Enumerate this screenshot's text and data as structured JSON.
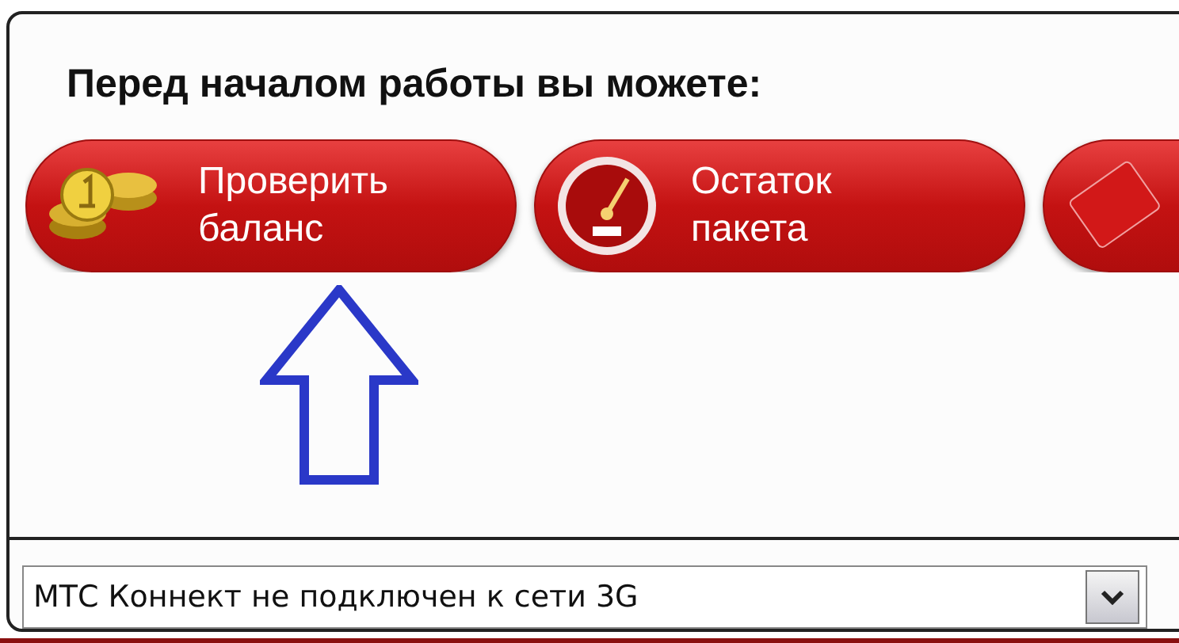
{
  "heading": "Перед началом работы вы можете:",
  "actions": [
    {
      "kind": "coins",
      "label": "Проверить баланс"
    },
    {
      "kind": "gauge",
      "label": "Остаток пакета"
    },
    {
      "kind": "card"
    }
  ],
  "status_select": {
    "value": "МТС Коннект не подключен к сети 3G"
  }
}
